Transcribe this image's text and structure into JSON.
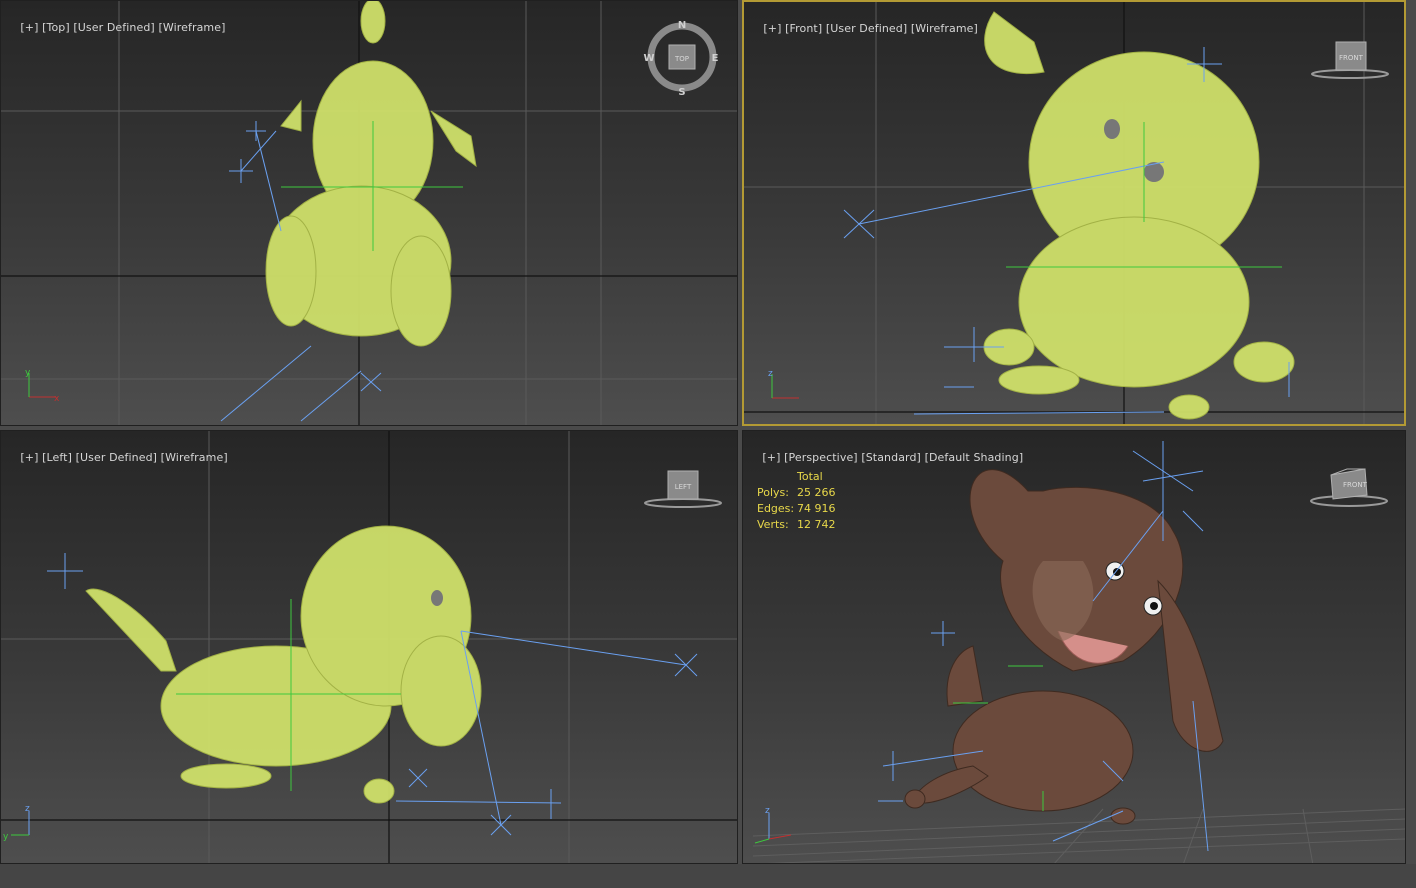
{
  "viewports": {
    "top": {
      "plus": "[+]",
      "view": "[Top]",
      "mode": "[User Defined]",
      "shading": "[Wireframe]",
      "cube_label": "TOP",
      "compass": {
        "n": "N",
        "s": "S",
        "e": "E",
        "w": "W"
      }
    },
    "front": {
      "plus": "[+]",
      "view": "[Front]",
      "mode": "[User Defined]",
      "shading": "[Wireframe]",
      "cube_label": "FRONT"
    },
    "left": {
      "plus": "[+]",
      "view": "[Left]",
      "mode": "[User Defined]",
      "shading": "[Wireframe]",
      "cube_label": "LEFT"
    },
    "perspective": {
      "plus": "[+]",
      "view": "[Perspective]",
      "mode": "[Standard]",
      "shading": "[Default Shading]",
      "cube_label": "FRONT"
    }
  },
  "stats": {
    "header": "Total",
    "rows": [
      {
        "label": "Polys:",
        "value": "25 266"
      },
      {
        "label": "Edges:",
        "value": "74 916"
      },
      {
        "label": "Verts:",
        "value": "12 742"
      }
    ]
  },
  "axes": {
    "x": "x",
    "y": "y",
    "z": "z"
  },
  "colors": {
    "wireframe": "#d8e86a",
    "bones": "#6aa0f0",
    "active_border": "#b39a34",
    "stats_text": "#e8d84a",
    "dog_body": "#6b4a3c"
  }
}
